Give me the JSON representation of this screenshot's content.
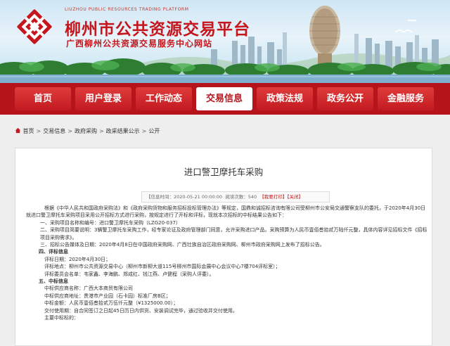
{
  "header": {
    "title_en": "LIUZHOU PUBLIC RESOURCES TRADING PLATFORM",
    "title_cn": "柳州市公共资源交易平台",
    "subtitle": "广西柳州公共资源交易服务中心网站"
  },
  "nav": {
    "items": [
      {
        "label": "首页"
      },
      {
        "label": "用户登录"
      },
      {
        "label": "工作动态"
      },
      {
        "label": "交易信息"
      },
      {
        "label": "政策法规"
      },
      {
        "label": "政务公开"
      },
      {
        "label": "金融服务"
      }
    ],
    "active_index": 3
  },
  "breadcrumb": {
    "items": [
      "首页",
      "交易信息",
      "政府采购",
      "政采结果公示",
      "公开"
    ],
    "separator": ">"
  },
  "article": {
    "title": "进口警卫摩托车采购",
    "meta": {
      "date_label": "【信息时间：",
      "date": "2020-05-21 00:00:00",
      "views_label": "阅读次数：",
      "views": "540",
      "print": "【我要打印】",
      "close": "【关闭】"
    },
    "paragraphs": [
      {
        "cls": "ind",
        "text": "根据《中华人民共和国政府采购法》和《政府采购货物和服务招标投标管理办法》等规定，国鼎和诚招标咨询有限公司受柳州市公安局交通警察支队的委托，于2020年4月30日就进口警卫摩托车采购项目采用公开招标方式进行采购，按规定进行了开标和评标，现就本次招标的中标结果公告如下："
      },
      {
        "cls": "l2",
        "text": "一、采购项目名称和编号：进口警卫摩托车采购（LZG20-037）"
      },
      {
        "cls": "l2",
        "text": "二、采购项目简要说明：3辆警卫摩托车采购工作，经专家论证及政府管理部门同意，允许采购进口产品。采购预算为人民币壹佰叁拾贰万陆仟元整，具体内容详见招标文件《招标项目采购需求》。"
      },
      {
        "cls": "l2",
        "text": "三、招标公告媒体及日期：2020年4月8日在中国政府采购网、广西壮族自治区政府采购网、柳州市政府采购网上发布了招标公告。"
      },
      {
        "cls": "sec",
        "text": "四、评标信息"
      },
      {
        "cls": "l3",
        "text": "评标日期：2020年4月30日；"
      },
      {
        "cls": "l3",
        "text": "评标地点：柳州市公共资源交易中心（柳州市新柳大道115号柳州市国际会展中心会议中心7楼704评标室）；"
      },
      {
        "cls": "l3",
        "text": "评标委员会名单：韦家鑫、李海鹏、郑成红、钱江燕、卢健程（采购人评委）。"
      },
      {
        "cls": "sec",
        "text": "五、中标信息"
      },
      {
        "cls": "l3",
        "text": "中标供应商名称：广西大本商贸有限公司"
      },
      {
        "cls": "l3",
        "text": "中标供应商地址：贵港市产业园（石卡园）标准厂房B区；"
      },
      {
        "cls": "l3",
        "text": "中标金额：人民币壹佰叁拾贰万伍仟元整（¥1325000.00）；"
      },
      {
        "cls": "l3",
        "text": "交付使用期：自合同签订之日起45日历日内供货、安装调试完毕，通过验收并交付使用。"
      },
      {
        "cls": "l3",
        "text": "主要中标标的："
      }
    ]
  },
  "colors": {
    "brand_red": "#b5141a",
    "nav_red": "#c11b21",
    "title_red": "#c4161c",
    "page_bg": "#eeeeee"
  },
  "icons": [
    "logo-icon",
    "home-icon"
  ]
}
